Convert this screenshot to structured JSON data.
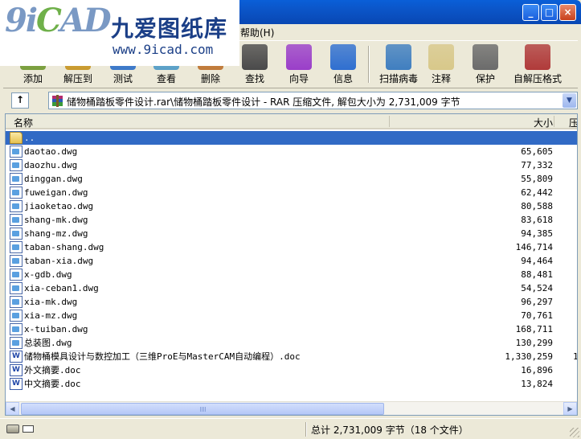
{
  "watermark": {
    "logo": "9iCAD",
    "name": "九爱图纸库",
    "url": "www.9icad.com"
  },
  "menubar": {
    "help": "帮助(H)"
  },
  "window_buttons": {
    "minimize": "_",
    "maximize": "□",
    "close": "×"
  },
  "toolbar": {
    "buttons": [
      {
        "label": "添加",
        "icon": "add-icon",
        "color": "#7a9f3e"
      },
      {
        "label": "解压到",
        "icon": "extract-to-icon",
        "color": "#c99a2e"
      },
      {
        "label": "测试",
        "icon": "test-icon",
        "color": "#3b78c9"
      },
      {
        "label": "查看",
        "icon": "view-icon",
        "color": "#5aa0c8"
      },
      {
        "label": "删除",
        "icon": "delete-icon",
        "color": "#c07a3a"
      },
      {
        "label": "查找",
        "icon": "find-icon",
        "color": "#4a4a4a"
      },
      {
        "label": "向导",
        "icon": "wizard-icon",
        "color": "#9a3ec9"
      },
      {
        "label": "信息",
        "icon": "info-icon",
        "color": "#2f6fd0"
      },
      {
        "label": "扫描病毒",
        "icon": "virus-scan-icon",
        "color": "#3f7ec0"
      },
      {
        "label": "注释",
        "icon": "comment-icon",
        "color": "#d8c88a"
      },
      {
        "label": "保护",
        "icon": "protect-icon",
        "color": "#6b6b6b"
      },
      {
        "label": "自解压格式",
        "icon": "sfx-icon",
        "color": "#b03a3a"
      }
    ]
  },
  "pathbar": {
    "up_label": "↑",
    "path": "储物桶踏板零件设计.rar\\储物桶踏板零件设计 - RAR 压缩文件, 解包大小为 2,731,009 字节"
  },
  "list": {
    "columns": {
      "name": "名称",
      "size": "大小",
      "packed": "压"
    },
    "rows": [
      {
        "name": "..",
        "size": "",
        "type": "folder",
        "selected": true
      },
      {
        "name": "daotao.dwg",
        "size": "65,605",
        "type": "dwg"
      },
      {
        "name": "daozhu.dwg",
        "size": "77,332",
        "type": "dwg"
      },
      {
        "name": "dinggan.dwg",
        "size": "55,809",
        "type": "dwg"
      },
      {
        "name": "fuweigan.dwg",
        "size": "62,442",
        "type": "dwg"
      },
      {
        "name": "jiaoketao.dwg",
        "size": "80,588",
        "type": "dwg"
      },
      {
        "name": "shang-mk.dwg",
        "size": "83,618",
        "type": "dwg"
      },
      {
        "name": "shang-mz.dwg",
        "size": "94,385",
        "type": "dwg"
      },
      {
        "name": "taban-shang.dwg",
        "size": "146,714",
        "type": "dwg"
      },
      {
        "name": "taban-xia.dwg",
        "size": "94,464",
        "type": "dwg"
      },
      {
        "name": "x-gdb.dwg",
        "size": "88,481",
        "type": "dwg"
      },
      {
        "name": "xia-ceban1.dwg",
        "size": "54,524",
        "type": "dwg"
      },
      {
        "name": "xia-mk.dwg",
        "size": "96,297",
        "type": "dwg"
      },
      {
        "name": "xia-mz.dwg",
        "size": "70,761",
        "type": "dwg"
      },
      {
        "name": "x-tuiban.dwg",
        "size": "168,711",
        "type": "dwg"
      },
      {
        "name": "总装图.dwg",
        "size": "130,299",
        "type": "dwg"
      },
      {
        "name": "储物桶模具设计与数控加工（三维ProE与MasterCAM自动编程）.doc",
        "size": "1,330,259",
        "type": "doc",
        "extra": "1"
      },
      {
        "name": "外文摘要.doc",
        "size": "16,896",
        "type": "doc"
      },
      {
        "name": "中文摘要.doc",
        "size": "13,824",
        "type": "doc"
      }
    ]
  },
  "scroll": {
    "left": "◀",
    "right": "▶"
  },
  "status": {
    "total": "总计 2,731,009 字节（18 个文件）"
  }
}
